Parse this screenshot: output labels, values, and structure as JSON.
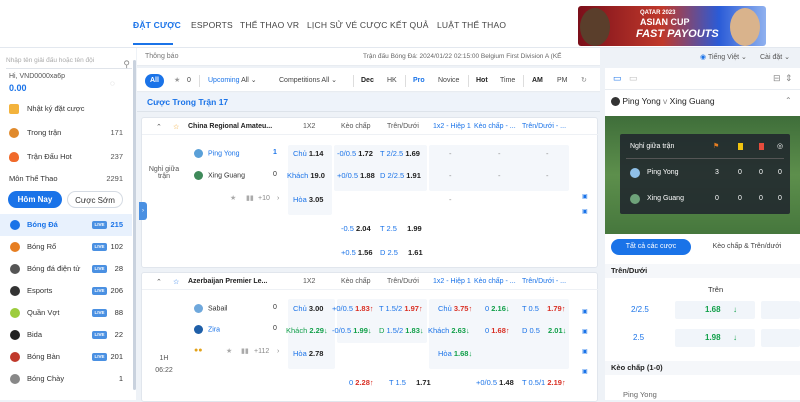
{
  "nav": {
    "items": [
      "ĐẶT CƯỢC",
      "ESPORTS",
      "THỂ THAO VR",
      "LỊCH SỬ VÉ CƯỢC",
      "KẾT QUẢ",
      "LUẬT THỂ THAO"
    ]
  },
  "banner": {
    "small": "QATAR 2023",
    "title": "ASIAN CUP",
    "promo": "FAST PAYOUTS"
  },
  "topright": {
    "language": "Tiếng Việt",
    "settings": "Cài đặt"
  },
  "sidebar": {
    "search_placeholder": "Nhập tên giải đấu hoặc tên đội",
    "greeting": "Hi, VND0000xa6p",
    "balance": "0.00",
    "links": [
      {
        "label": "Nhật ký đặt cược",
        "count": ""
      },
      {
        "label": "Trong trận",
        "count": "171"
      },
      {
        "label": "Trận Đấu Hot",
        "count": "237"
      }
    ],
    "all_sports_label": "Môn Thể Thao",
    "all_sports_count": "2291",
    "tab_today": "Hôm Nay",
    "tab_early": "Cược Sớm",
    "live_badge": "LIVE",
    "sports": [
      {
        "label": "Bóng Đá",
        "count": "215",
        "live": true,
        "color": "#1a73e8"
      },
      {
        "label": "Bóng Rổ",
        "count": "102",
        "live": true,
        "color": "#e67e22"
      },
      {
        "label": "Bóng đá điện tử",
        "count": "28",
        "live": true,
        "color": "#555"
      },
      {
        "label": "Esports",
        "count": "206",
        "live": true,
        "color": "#333"
      },
      {
        "label": "Quần Vợt",
        "count": "88",
        "live": true,
        "color": "#9ccc3c"
      },
      {
        "label": "Bida",
        "count": "22",
        "live": true,
        "color": "#222"
      },
      {
        "label": "Bóng Bàn",
        "count": "201",
        "live": true,
        "color": "#c0392b"
      },
      {
        "label": "Bóng Chày",
        "count": "1",
        "live": false,
        "color": "#888"
      }
    ]
  },
  "subheader": {
    "notice": "Thông báo",
    "ticker": "Trận đấu Bóng Đá: 2024/01/22 02:15:00 Belgium First Division A (KẾ"
  },
  "filters": {
    "all": "All",
    "fav_count": "0",
    "upcoming": "Upcoming",
    "upcoming_val": "All",
    "competitions": "Competitions",
    "competitions_val": "All",
    "dec": "Dec",
    "hk": "HK",
    "pro": "Pro",
    "novice": "Novice",
    "hot": "Hot",
    "time": "Time",
    "am": "AM",
    "pm": "PM"
  },
  "section_title": "Cược Trong Trận 17",
  "columns": {
    "c1": "1X2",
    "c2": "Kèo chấp",
    "c3": "Trên/Dưới",
    "c4": "1x2 - Hiệp 1",
    "c5": "Kèo chấp - ...",
    "c6": "Trên/Dưới - ..."
  },
  "match1": {
    "league": "China Regional Amateu...",
    "status": "Nghỉ giữa trận",
    "home": "Ping Yong",
    "away": "Xing Guang",
    "home_score": "1",
    "away_score": "0",
    "more": "+10",
    "row1": {
      "l": "Chủ",
      "o": "1.14",
      "hc": "-0/0.5",
      "ho": "1.72",
      "t": "T",
      "tl": "2/2.5",
      "to": "1.69"
    },
    "row2": {
      "l": "Khách",
      "o": "19.0",
      "hc": "+0/0.5",
      "ho": "1.88",
      "t": "D",
      "tl": "2/2.5",
      "to": "1.91"
    },
    "row3": {
      "l": "Hòa",
      "o": "3.05"
    },
    "dash": "-",
    "extra1": {
      "hc": "-0.5",
      "ho": "2.04",
      "t": "T",
      "tl": "2.5",
      "to": "1.99"
    },
    "extra2": {
      "hc": "+0.5",
      "ho": "1.56",
      "t": "D",
      "tl": "2.5",
      "to": "1.61"
    }
  },
  "match2": {
    "league": "Azerbaijan Premier Le...",
    "time1": "1H",
    "time2": "06:22",
    "home": "Sabail",
    "away": "Zira",
    "home_score": "0",
    "away_score": "0",
    "more": "+112",
    "row1": {
      "l": "Chủ",
      "o": "3.00",
      "hc": "+0/0.5",
      "ho": "1.83",
      "t": "T",
      "tl": "1.5/2",
      "to": "1.97",
      "h1l": "Chủ",
      "h1o": "3.75",
      "hc1": "0",
      "ho1": "2.16",
      "t1": "T",
      "tl1": "0.5",
      "to1": "1.79"
    },
    "row2": {
      "l": "Khách",
      "o": "2.29",
      "hc": "-0/0.5",
      "ho": "1.99",
      "t": "D",
      "tl": "1.5/2",
      "to": "1.83",
      "h1l": "Khách",
      "h1o": "2.63",
      "hc1": "0",
      "ho1": "1.68",
      "t1": "D",
      "tl1": "0.5",
      "to1": "2.01"
    },
    "row3": {
      "l": "Hòa",
      "o": "2.78",
      "h1l": "Hòa",
      "h1o": "1.68"
    },
    "extra1": {
      "hc": "0",
      "ho": "2.28",
      "t": "T",
      "tl": "1.5",
      "to": "1.71",
      "hc1": "+0/0.5",
      "ho1": "1.48",
      "t1": "T",
      "tl1": "0.5/1",
      "to1": "2.19"
    }
  },
  "rightpanel": {
    "home": "Ping Yong",
    "vs": "v",
    "away": "Xing Guang",
    "status": "Nghỉ giữa trận",
    "sb": [
      {
        "team": "Ping Yong",
        "a": "3",
        "b": "0",
        "c": "0",
        "d": "0"
      },
      {
        "team": "Xing Guang",
        "a": "0",
        "b": "0",
        "c": "0",
        "d": "0"
      }
    ],
    "tab_all": "Tất cả các cược",
    "tab_hdp": "Kèo chấp & Trên/dưới",
    "ou_title": "Trên/Dưới",
    "ou_over": "Trên",
    "ou_rows": [
      {
        "line": "2/2.5",
        "odds": "1.68"
      },
      {
        "line": "2.5",
        "odds": "1.98"
      }
    ],
    "hdp_title": "Kèo chấp (1-0)",
    "hdp_team": "Ping Yong"
  },
  "colors": {
    "accent": "#1a73e8",
    "positive": "#12a04a",
    "negative": "#d93025"
  }
}
